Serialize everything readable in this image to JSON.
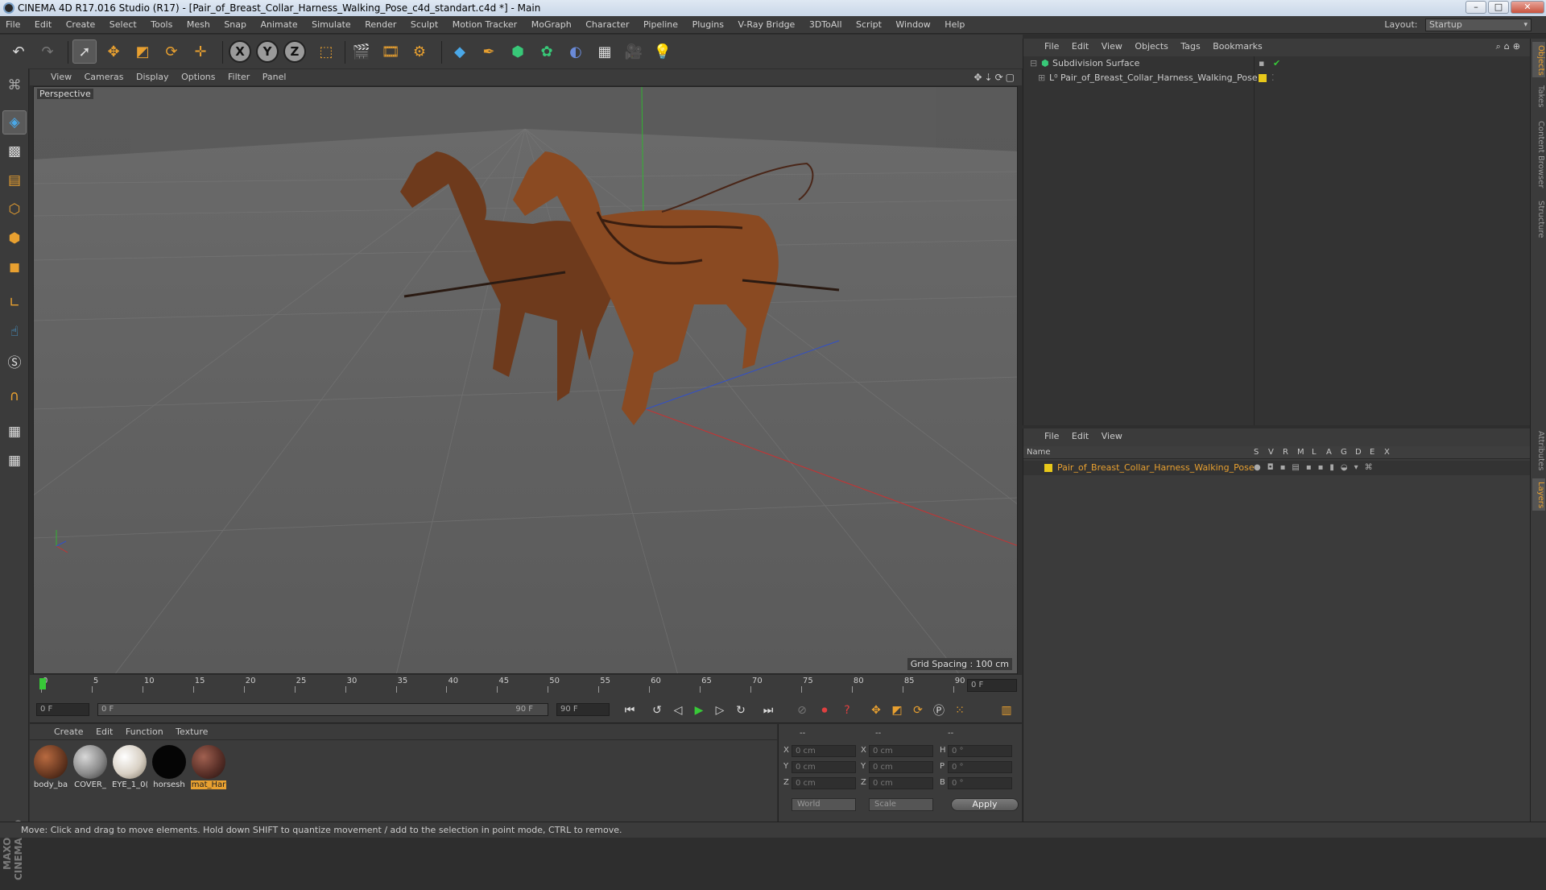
{
  "window": {
    "title": "CINEMA 4D R17.016 Studio (R17) - [Pair_of_Breast_Collar_Harness_Walking_Pose_c4d_standart.c4d *] - Main"
  },
  "menubar": {
    "items": [
      "File",
      "Edit",
      "Create",
      "Select",
      "Tools",
      "Mesh",
      "Snap",
      "Animate",
      "Simulate",
      "Render",
      "Sculpt",
      "Motion Tracker",
      "MoGraph",
      "Character",
      "Pipeline",
      "Plugins",
      "V-Ray Bridge",
      "3DToAll",
      "Script",
      "Window",
      "Help"
    ],
    "layout_label": "Layout:",
    "layout_value": "Startup"
  },
  "toolbar": {
    "undo_icon": "undo-icon",
    "redo_icon": "redo-icon",
    "axis_x": "X",
    "axis_y": "Y",
    "axis_z": "Z"
  },
  "viewport": {
    "menu": [
      "View",
      "Cameras",
      "Display",
      "Options",
      "Filter",
      "Panel"
    ],
    "camera_label": "Perspective",
    "grid_spacing": "Grid Spacing : 100 cm"
  },
  "timeline": {
    "ticks": [
      "0",
      "5",
      "10",
      "15",
      "20",
      "25",
      "30",
      "35",
      "40",
      "45",
      "50",
      "55",
      "60",
      "65",
      "70",
      "75",
      "80",
      "85",
      "90"
    ],
    "current_frame": "0 F"
  },
  "transport": {
    "start_frame": "0 F",
    "range_start": "0 F",
    "range_end": "90 F",
    "end_frame": "90 F"
  },
  "materials": {
    "menu": [
      "Create",
      "Edit",
      "Function",
      "Texture"
    ],
    "items": [
      {
        "name": "body_ba",
        "color": "#6b3a22"
      },
      {
        "name": "COVER_",
        "color": "#8a8a8a"
      },
      {
        "name": "EYE_1_0(",
        "color": "#d8d0c4"
      },
      {
        "name": "horsesh",
        "color": "#050505"
      },
      {
        "name": "mat_Har",
        "color": "#5a3028",
        "selected": true
      }
    ]
  },
  "coords": {
    "header": [
      "--",
      "--",
      "--"
    ],
    "rows": [
      {
        "a": "X",
        "av": "0 cm",
        "b": "X",
        "bv": "0 cm",
        "c": "H",
        "cv": "0 °"
      },
      {
        "a": "Y",
        "av": "0 cm",
        "b": "Y",
        "bv": "0 cm",
        "c": "P",
        "cv": "0 °"
      },
      {
        "a": "Z",
        "av": "0 cm",
        "b": "Z",
        "bv": "0 cm",
        "c": "B",
        "cv": "0 °"
      }
    ],
    "mode": "World",
    "type": "Scale",
    "apply": "Apply"
  },
  "objects": {
    "menu": [
      "File",
      "Edit",
      "View",
      "Objects",
      "Tags",
      "Bookmarks"
    ],
    "tree": [
      {
        "name": "Subdivision Surface",
        "level": 0
      },
      {
        "name": "Pair_of_Breast_Collar_Harness_Walking_Pose",
        "level": 1
      }
    ]
  },
  "layers": {
    "menu": [
      "File",
      "Edit",
      "View"
    ],
    "columns": [
      "Name",
      "S",
      "V",
      "R",
      "M",
      "L",
      "A",
      "G",
      "D",
      "E",
      "X"
    ],
    "rows": [
      {
        "name": "Pair_of_Breast_Collar_Harness_Walking_Pose",
        "color": "#e8c81a"
      }
    ]
  },
  "right_tabs": [
    "Objects",
    "Takes",
    "Content Browser",
    "Structure",
    "Attributes",
    "Layers"
  ],
  "status": "Move: Click and drag to move elements. Hold down SHIFT to quantize movement / add to the selection in point mode, CTRL to remove.",
  "branding": "MAXON CINEMA 4D",
  "colors": {
    "accent": "#e8a030",
    "panel": "#3b3b3b",
    "x_axis": "#c83232",
    "y_axis": "#32b432",
    "z_axis": "#3250c8"
  }
}
